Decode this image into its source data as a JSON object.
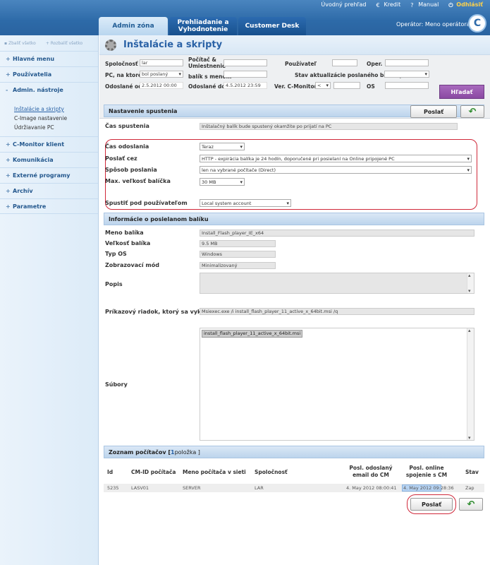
{
  "top": {
    "links": [
      "Úvodný prehľad",
      "Kredit",
      "Manual",
      "Odhlásiť"
    ],
    "operator": "Operátor: Meno operátora",
    "logo": "C"
  },
  "tabs": [
    "Admin zóna",
    "Prehliadanie a Vyhodnotenie",
    "Customer Desk"
  ],
  "sidebar": {
    "expand": "Zbaliť všetko",
    "collapse": "Rozbaliť všetko",
    "items": [
      {
        "label": "Hlavné menu",
        "sign": "+"
      },
      {
        "label": "Používatelia",
        "sign": "+"
      },
      {
        "label": "Admin. nástroje",
        "sign": "-"
      }
    ],
    "subitems": [
      "Inštalácie a skripty",
      "C-Image nastavenie",
      "Údržiavanie PC"
    ],
    "items2": [
      {
        "label": "C-Monitor klient",
        "sign": "+"
      },
      {
        "label": "Komunikácia",
        "sign": "+"
      },
      {
        "label": "Externé programy",
        "sign": "+"
      },
      {
        "label": "Archív",
        "sign": "+"
      },
      {
        "label": "Parametre",
        "sign": "+"
      }
    ]
  },
  "page": {
    "title": "Inštalácie a skripty"
  },
  "filters": {
    "spolocnost_l": "Spoločnosť",
    "spolocnost_v": "lar",
    "pocitac_l": "Počítač & Umiestnenie",
    "pouzivatel_l": "Používateľ",
    "oper_l": "Oper.",
    "pc_l": "PC, na ktoré",
    "pc_v": "bol poslaný",
    "balik_l": "balík s menom",
    "stav_l": "Stav aktualizácie poslaného balíka je",
    "od_l": "Odoslané od",
    "od_v": "2.5.2012 00:00",
    "do_l": "Odoslané do",
    "do_v": "4.5.2012 23:59",
    "ver_l": "Ver. C-Monitora",
    "ver_v": "<",
    "os_l": "OS",
    "search": "Hľadať"
  },
  "nastavenie": {
    "header": "Nastavenie spustenia",
    "send": "Poslať",
    "cas_spustenia_l": "Čas spustenia",
    "cas_spustenia_v": "Inštalačný balík bude spustený okamžite po prijatí na PC",
    "cas_odoslania_l": "Čas odoslania",
    "cas_odoslania_v": "Teraz",
    "poslat_cez_l": "Poslať cez",
    "poslat_cez_v": "HTTP - expirácia balíka je 24 hodín, doporučené pri posielaní na Online pripojené PC",
    "sposob_l": "Spôsob poslania",
    "sposob_v": "len na vybrané počítače (Direct)",
    "max_l": "Max. veľkosť balíčka",
    "max_v": "30 MB",
    "spustit_l": "Spustiť pod používateľom",
    "spustit_v": "Local system account"
  },
  "info": {
    "header": "Informácie o posielanom balíku",
    "meno_l": "Meno balíka",
    "meno_v": "Install_Flash_player_IE_x64",
    "velkost_l": "Veľkosť balíka",
    "velkost_v": "9.5 MB",
    "typ_l": "Typ OS",
    "typ_v": "Windows",
    "mod_l": "Zobrazovací mód",
    "mod_v": "Minimalizovaný",
    "popis_l": "Popis",
    "prikaz_l": "Príkazový riadok, ktorý sa vykoná",
    "prikaz_v": "Msiexec.exe /i install_flash_player_11_active_x_64bit.msi /q",
    "subory_l": "Súbory",
    "subory_v": "install_flash_player_11_active_x_64bit.msi"
  },
  "zoznam": {
    "header_a": "Zoznam počítačov [ ",
    "count": "1",
    "header_b": " položka ]",
    "cols": [
      "Id",
      "CM-ID počítača",
      "Meno počítača v sieti",
      "Spoločnosť",
      "Posl. odoslaný email do CM",
      "Posl. online spojenie s CM",
      "Stav"
    ],
    "row": [
      "5235",
      "LASV01",
      "SERVER",
      "LAR",
      "4. May 2012 08:00:41",
      "4. May 2012 09:28:36",
      "Zap"
    ],
    "send": "Poslať"
  }
}
